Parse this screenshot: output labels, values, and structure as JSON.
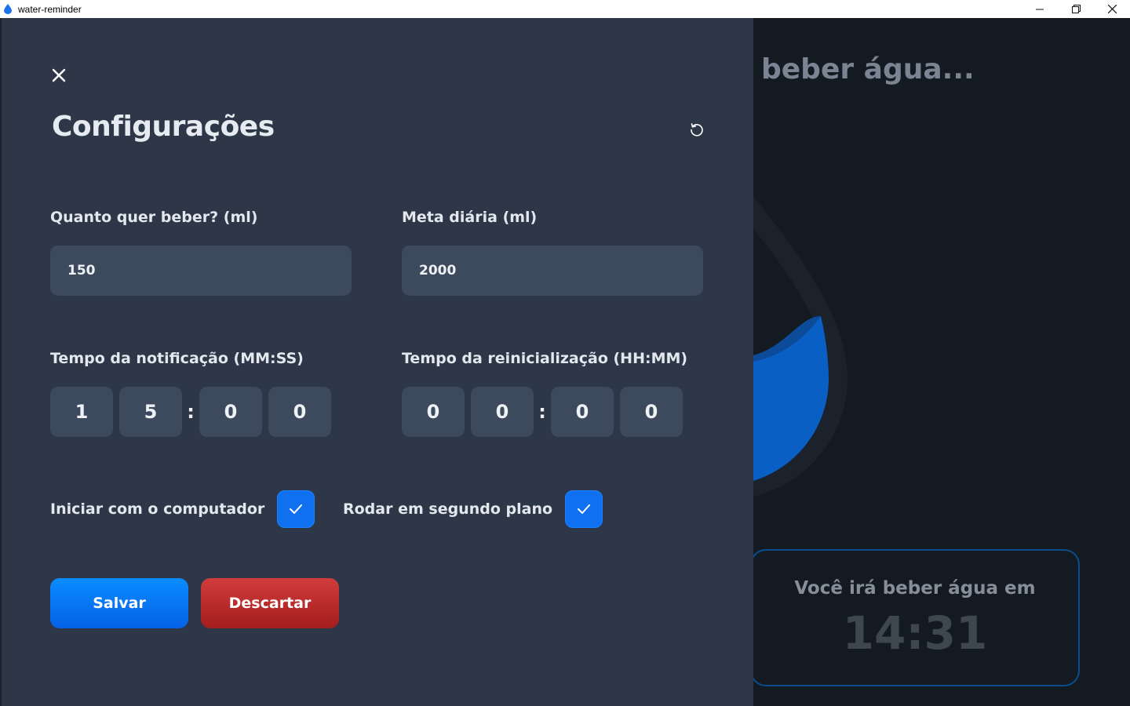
{
  "window": {
    "title": "water-reminder",
    "controls": {
      "minimize": "—",
      "maximize": "❐",
      "close": "✕"
    }
  },
  "background": {
    "heading": "beber água...",
    "card": {
      "label": "Você irá beber água em",
      "time": "14:31"
    },
    "drop_fill_color": "#0a5fc4"
  },
  "settings": {
    "title": "Configurações",
    "amount": {
      "label": "Quanto quer beber? (ml)",
      "value": "150"
    },
    "daily_goal": {
      "label": "Meta diária (ml)",
      "value": "2000"
    },
    "notification_time": {
      "label": "Tempo da notificação (MM:SS)",
      "digits": [
        "1",
        "5",
        "0",
        "0"
      ]
    },
    "reset_time": {
      "label": "Tempo da reinicialização (HH:MM)",
      "digits": [
        "0",
        "0",
        "0",
        "0"
      ]
    },
    "start_with_computer": {
      "label": "Iniciar com o computador",
      "checked": true
    },
    "run_in_background": {
      "label": "Rodar em segundo plano",
      "checked": true
    },
    "save_label": "Salvar",
    "discard_label": "Descartar",
    "colon": ":"
  },
  "colors": {
    "panel": "#2d3748",
    "input": "#3d4a5d",
    "accent": "#1071f0",
    "danger": "#c03030"
  }
}
